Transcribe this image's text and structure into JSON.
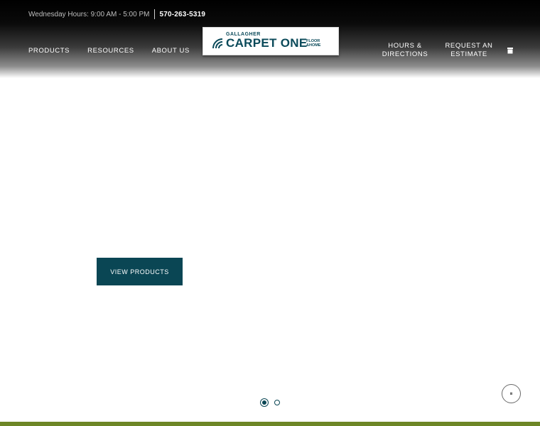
{
  "topbar": {
    "hours": "Wednesday Hours: 9:00 AM - 5:00 PM",
    "phone": "570-263-5319"
  },
  "nav_left": [
    "PRODUCTS",
    "RESOURCES",
    "ABOUT US"
  ],
  "nav_right": [
    {
      "line1": "HOURS &",
      "line2": "DIRECTIONS"
    },
    {
      "line1": "REQUEST AN",
      "line2": "ESTIMATE"
    }
  ],
  "logo": {
    "top": "GALLAGHER",
    "main": "CARPET ONE",
    "floor": "FLOOR",
    "home": "&HOME"
  },
  "hero": {
    "cta_label": "VIEW PRODUCTS"
  },
  "carousel": {
    "slides": 2,
    "active": 1,
    "pause_label": "⏸"
  },
  "colors": {
    "accent": "#0a4654",
    "bottom_bar": "#6d8626"
  },
  "icons": [
    "cart-icon",
    "pause-icon"
  ]
}
